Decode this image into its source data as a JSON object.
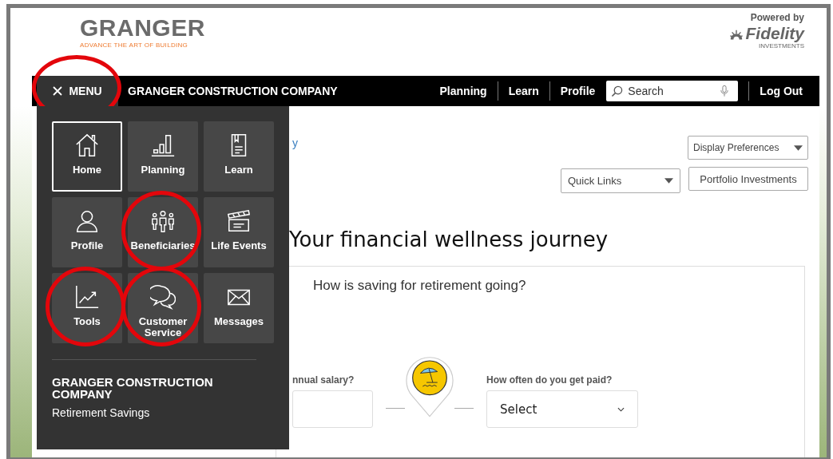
{
  "header": {
    "logo_name": "GRANGER",
    "logo_tagline": "ADVANCE THE ART OF BUILDING",
    "powered_by": "Powered by",
    "partner_name": "Fidelity",
    "partner_sub": "INVESTMENTS"
  },
  "nav": {
    "menu_button": {
      "label": "MENU",
      "expanded": true,
      "circled": true
    },
    "company": "GRANGER CONSTRUCTION COMPANY",
    "links": [
      {
        "label": "Planning"
      },
      {
        "label": "Learn"
      },
      {
        "label": "Profile"
      }
    ],
    "search": {
      "placeholder": "Search"
    },
    "logout": "Log Out"
  },
  "menu": {
    "tiles": [
      {
        "label": "Home",
        "kind": "home",
        "selected": true,
        "circled": false
      },
      {
        "label": "Planning",
        "kind": "planning",
        "selected": false,
        "circled": false
      },
      {
        "label": "Learn",
        "kind": "learn",
        "selected": false,
        "circled": false
      },
      {
        "label": "Profile",
        "kind": "profile",
        "selected": false,
        "circled": false
      },
      {
        "label": "Beneficiaries",
        "kind": "beneficiaries",
        "selected": false,
        "circled": true
      },
      {
        "label": "Life Events",
        "kind": "events",
        "selected": false,
        "circled": false
      },
      {
        "label": "Tools",
        "kind": "tools",
        "selected": false,
        "circled": true
      },
      {
        "label": "Customer Service",
        "kind": "service",
        "selected": false,
        "circled": true
      },
      {
        "label": "Messages",
        "kind": "messages",
        "selected": false,
        "circled": false
      }
    ],
    "company": "GRANGER CONSTRUCTION COMPANY",
    "plan": "Retirement Savings"
  },
  "content": {
    "link_fragment": "y",
    "display_preferences": "Display Preferences",
    "quick_links": "Quick Links",
    "portfolio_button": "Portfolio Investments",
    "heading": "Your financial wellness journey",
    "question": "How is saving for retirement going?",
    "salary_label": "nnual salary?",
    "pay_label": "How often do you get paid?",
    "pay_select": "Select"
  }
}
